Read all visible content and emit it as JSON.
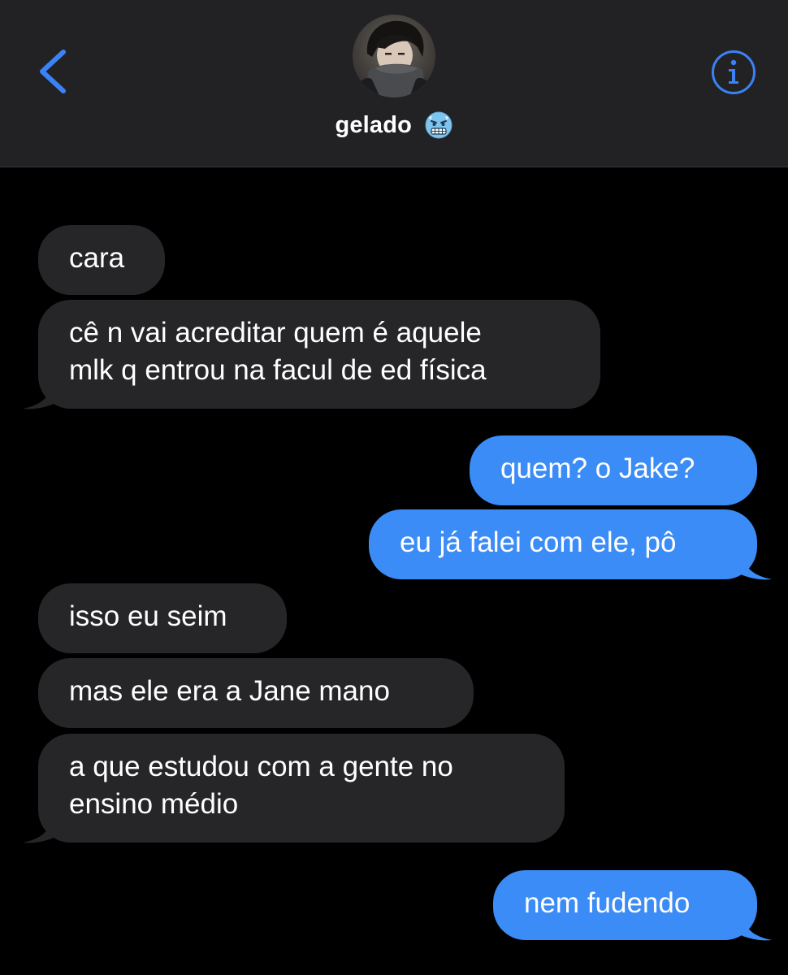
{
  "header": {
    "contact_name": "gelado",
    "contact_emoji": "cold-face-emoji",
    "back_icon": "chevron-left-icon",
    "info_icon": "info-icon",
    "avatar": "contact-avatar-photo",
    "accent_color": "#3b82f6"
  },
  "messages": [
    {
      "direction": "received",
      "lines": [
        "cara"
      ]
    },
    {
      "direction": "received",
      "lines": [
        "cê n vai acreditar quem é aquele",
        "mlk q entrou na facul de ed física"
      ]
    },
    {
      "direction": "sent",
      "lines": [
        "quem? o Jake?"
      ]
    },
    {
      "direction": "sent",
      "lines": [
        "eu já falei com ele, pô"
      ]
    },
    {
      "direction": "received",
      "lines": [
        "isso eu seim"
      ]
    },
    {
      "direction": "received",
      "lines": [
        "mas ele era a Jane mano"
      ]
    },
    {
      "direction": "received",
      "lines": [
        "a que estudou com a gente no",
        "ensino médio"
      ]
    },
    {
      "direction": "sent",
      "lines": [
        "nem fudendo"
      ]
    }
  ],
  "colors": {
    "header_bg": "#222224",
    "received_bubble": "#262628",
    "sent_bubble": "#3b8cf6",
    "background": "#000000"
  }
}
